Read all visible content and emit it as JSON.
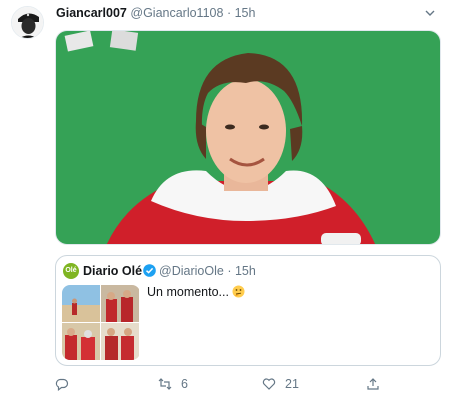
{
  "tweet": {
    "display_name": "Giancarl007",
    "handle": "@Giancarlo1108",
    "separator": "·",
    "time": "15h"
  },
  "quoted": {
    "logo_text": "Olé",
    "display_name": "Diario Olé",
    "handle": "@DiarioOle",
    "separator": "·",
    "time": "15h",
    "text": "Un momento..."
  },
  "actions": {
    "reply_count": "",
    "retweet_count": "6",
    "like_count": "21"
  },
  "colors": {
    "accent": "#1da1f2",
    "green_screen": "#3aa65a",
    "santa_red": "#d01f2a",
    "ole_green": "#7fb522"
  }
}
